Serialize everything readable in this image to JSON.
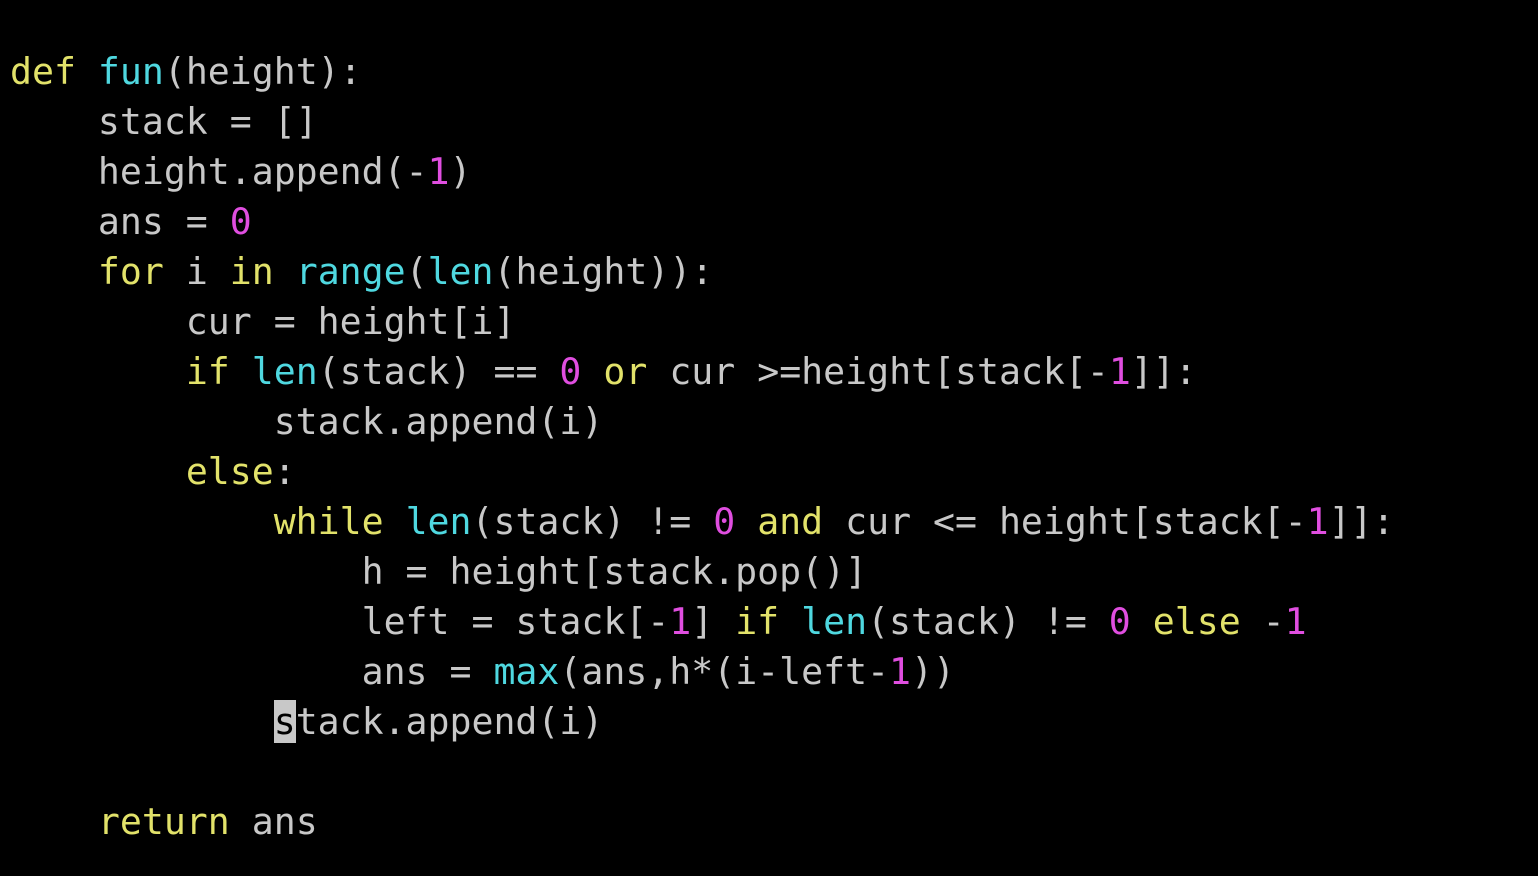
{
  "colors": {
    "background": "#000000",
    "text": "#c8c8c8",
    "keyword": "#e2e26a",
    "builtin": "#4fd8e0",
    "number": "#e04ee0",
    "cursor": "#c8c8c8"
  },
  "editor": {
    "cursor": {
      "line": 14,
      "column": 12
    },
    "lines": [
      [
        [
          "kw",
          "def"
        ],
        [
          "txt",
          " "
        ],
        [
          "fn",
          "fun"
        ],
        [
          "txt",
          "(height):"
        ]
      ],
      [
        [
          "txt",
          "    stack = []"
        ]
      ],
      [
        [
          "txt",
          "    height.append(-"
        ],
        [
          "num",
          "1"
        ],
        [
          "txt",
          ")"
        ]
      ],
      [
        [
          "txt",
          "    ans = "
        ],
        [
          "num",
          "0"
        ]
      ],
      [
        [
          "txt",
          "    "
        ],
        [
          "kw",
          "for"
        ],
        [
          "txt",
          " i "
        ],
        [
          "kw",
          "in"
        ],
        [
          "txt",
          " "
        ],
        [
          "fn",
          "range"
        ],
        [
          "txt",
          "("
        ],
        [
          "fn",
          "len"
        ],
        [
          "txt",
          "(height)):"
        ]
      ],
      [
        [
          "txt",
          "        cur = height[i]"
        ]
      ],
      [
        [
          "txt",
          "        "
        ],
        [
          "kw",
          "if"
        ],
        [
          "txt",
          " "
        ],
        [
          "fn",
          "len"
        ],
        [
          "txt",
          "(stack) == "
        ],
        [
          "num",
          "0"
        ],
        [
          "txt",
          " "
        ],
        [
          "kw",
          "or"
        ],
        [
          "txt",
          " cur >=height[stack[-"
        ],
        [
          "num",
          "1"
        ],
        [
          "txt",
          "]]:"
        ]
      ],
      [
        [
          "txt",
          "            stack.append(i)"
        ]
      ],
      [
        [
          "txt",
          "        "
        ],
        [
          "kw",
          "else"
        ],
        [
          "txt",
          ":"
        ]
      ],
      [
        [
          "txt",
          "            "
        ],
        [
          "kw",
          "while"
        ],
        [
          "txt",
          " "
        ],
        [
          "fn",
          "len"
        ],
        [
          "txt",
          "(stack) != "
        ],
        [
          "num",
          "0"
        ],
        [
          "txt",
          " "
        ],
        [
          "kw",
          "and"
        ],
        [
          "txt",
          " cur <= height[stack[-"
        ],
        [
          "num",
          "1"
        ],
        [
          "txt",
          "]]:"
        ]
      ],
      [
        [
          "txt",
          "                h = height[stack.pop()]"
        ]
      ],
      [
        [
          "txt",
          "                left = stack[-"
        ],
        [
          "num",
          "1"
        ],
        [
          "txt",
          "] "
        ],
        [
          "kw",
          "if"
        ],
        [
          "txt",
          " "
        ],
        [
          "fn",
          "len"
        ],
        [
          "txt",
          "(stack) != "
        ],
        [
          "num",
          "0"
        ],
        [
          "txt",
          " "
        ],
        [
          "kw",
          "else"
        ],
        [
          "txt",
          " -"
        ],
        [
          "num",
          "1"
        ]
      ],
      [
        [
          "txt",
          "                ans = "
        ],
        [
          "fn",
          "max"
        ],
        [
          "txt",
          "(ans,h*(i-left-"
        ],
        [
          "num",
          "1"
        ],
        [
          "txt",
          "))"
        ]
      ],
      [
        [
          "txt",
          "            stack.append(i)"
        ]
      ],
      [
        [
          "txt",
          ""
        ]
      ],
      [
        [
          "txt",
          "    "
        ],
        [
          "kw",
          "return"
        ],
        [
          "txt",
          " ans"
        ]
      ]
    ]
  }
}
